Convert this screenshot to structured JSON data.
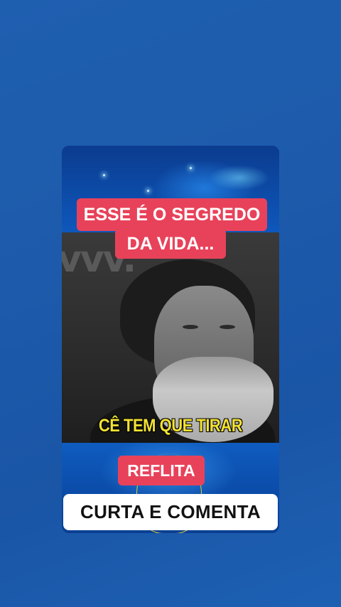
{
  "video": {
    "title_line1": "ESSE É O SEGREDO",
    "title_line2": "DA VIDA...",
    "caption": "CÊ TEM QUE TIRAR",
    "background_word": "vvv.",
    "label": "REFLITA",
    "cta": "CURTA E COMENTA"
  },
  "colors": {
    "background": "#1d5aab",
    "title_pill": "#e8425a",
    "caption_text": "#f2e233",
    "cta_background": "#ffffff"
  }
}
